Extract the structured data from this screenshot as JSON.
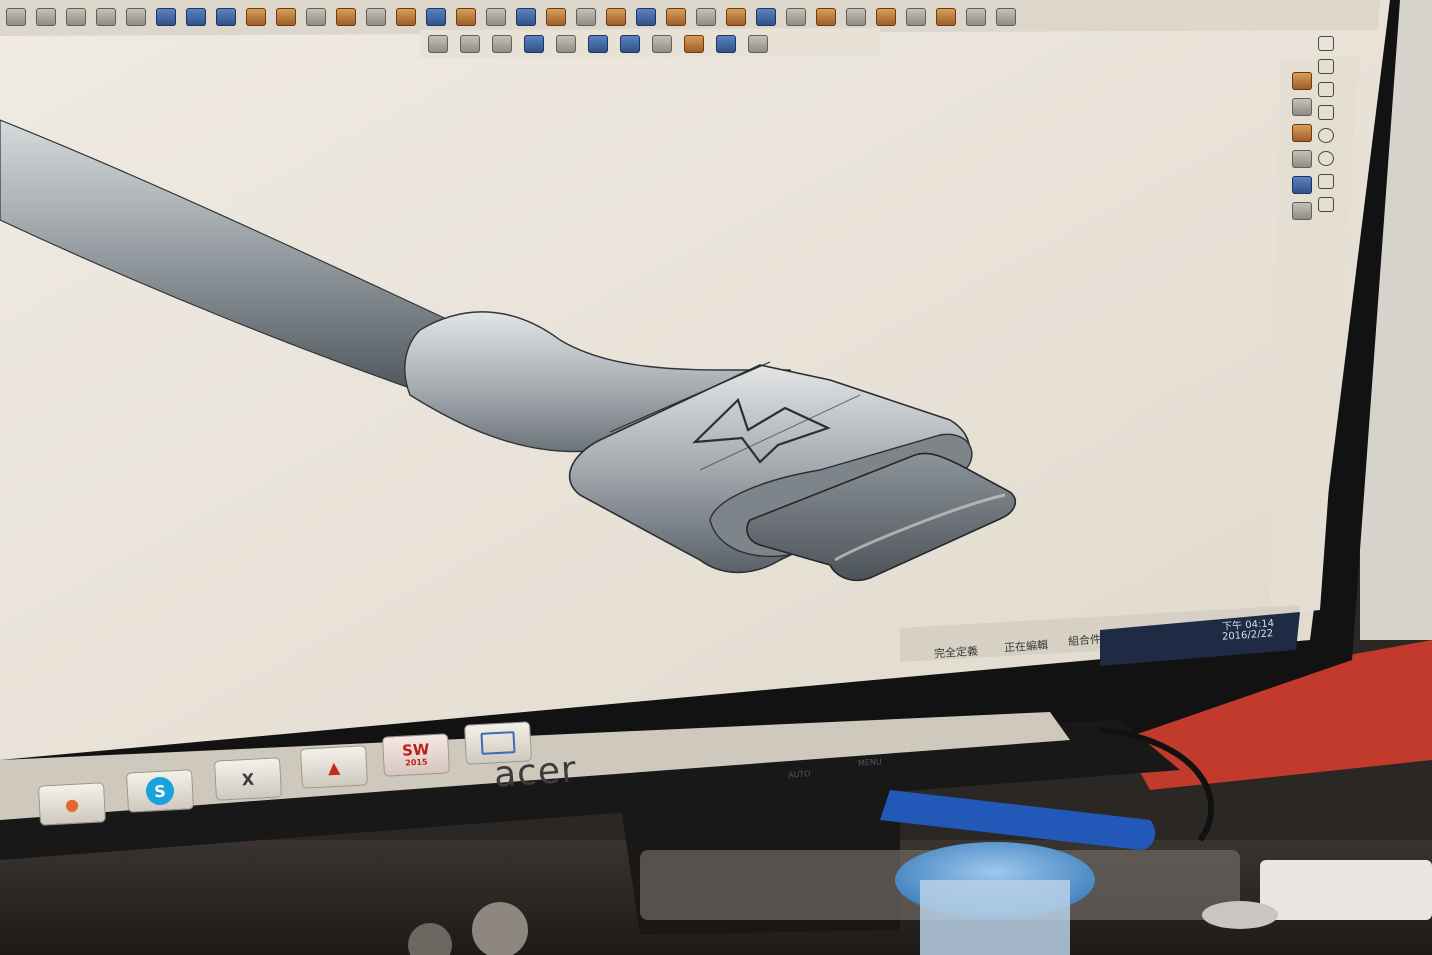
{
  "screen": {
    "title": "",
    "status_bar": [
      "完全定義",
      "正在編輯",
      "組合件"
    ],
    "clock_time": "下午 04:14",
    "clock_date": "2016/2/22"
  },
  "taskbar": {
    "sw_label": "SW",
    "sw_sub": "2015",
    "skype_letter": "S",
    "app_x_letter": "X"
  },
  "monitor": {
    "brand": "acer",
    "buttons": [
      "AUTO",
      "MENU"
    ]
  },
  "colors": {
    "viewport": "#ece6dc",
    "bezel": "#121212",
    "model": "#8c949b",
    "desk_red": "#c23a2c"
  },
  "icons": {
    "toolbar": "cad-toolbar-icon",
    "lightning": "lightning-bolt-icon",
    "skype": "skype-icon",
    "pdf": "pdf-icon",
    "solidworks": "solidworks-icon"
  }
}
